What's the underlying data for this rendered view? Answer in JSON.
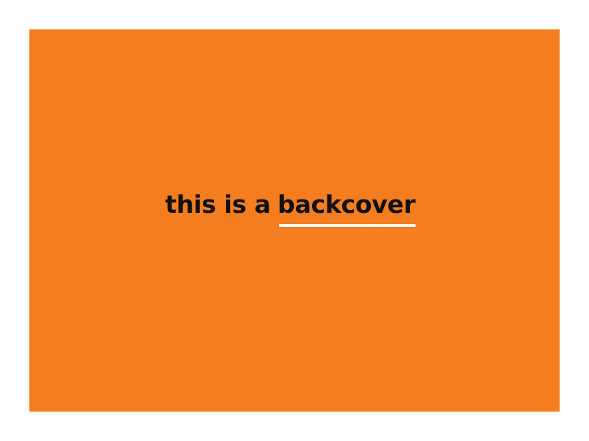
{
  "cover": {
    "background_color": "#F47D20",
    "headline_lead": "this is a",
    "headline_emphasis": "backcover",
    "underline_color": "#ffffff",
    "text_color": "#111111"
  }
}
